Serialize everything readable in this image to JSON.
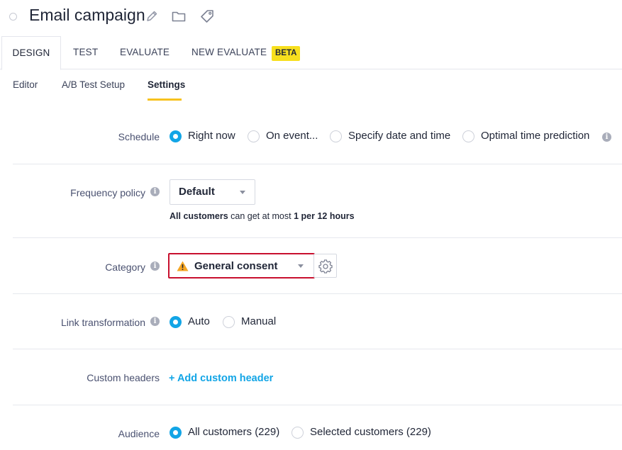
{
  "header": {
    "title": "Email campaign",
    "icons": [
      "pencil-icon",
      "folder-icon",
      "tag-icon"
    ]
  },
  "tabs": [
    {
      "label": "DESIGN",
      "active": true
    },
    {
      "label": "TEST",
      "active": false
    },
    {
      "label": "EVALUATE",
      "active": false
    },
    {
      "label": "NEW EVALUATE",
      "active": false,
      "badge": "BETA"
    }
  ],
  "subtabs": [
    {
      "label": "Editor",
      "active": false
    },
    {
      "label": "A/B Test Setup",
      "active": false
    },
    {
      "label": "Settings",
      "active": true
    }
  ],
  "schedule": {
    "label": "Schedule",
    "options": [
      "Right now",
      "On event...",
      "Specify date and time",
      "Optimal time prediction"
    ],
    "selected": "Right now"
  },
  "frequency": {
    "label": "Frequency policy",
    "value": "Default",
    "note_subject": "All customers",
    "note_middle": " can get at most ",
    "note_limit": "1 per 12 hours"
  },
  "category": {
    "label": "Category",
    "value": "General consent",
    "warning_color": "#f5a623",
    "error_border_color": "#c8102e"
  },
  "link_transformation": {
    "label": "Link transformation",
    "options": [
      "Auto",
      "Manual"
    ],
    "selected": "Auto"
  },
  "custom_headers": {
    "label": "Custom headers",
    "link": "+ Add custom header"
  },
  "audience": {
    "label": "Audience",
    "options": [
      "All customers (229)",
      "Selected customers (229)"
    ],
    "selected": "All customers (229)"
  },
  "colors": {
    "accent": "#12a5e6",
    "beta_badge": "#f7df1e",
    "subtab_underline": "#f7c21e"
  }
}
